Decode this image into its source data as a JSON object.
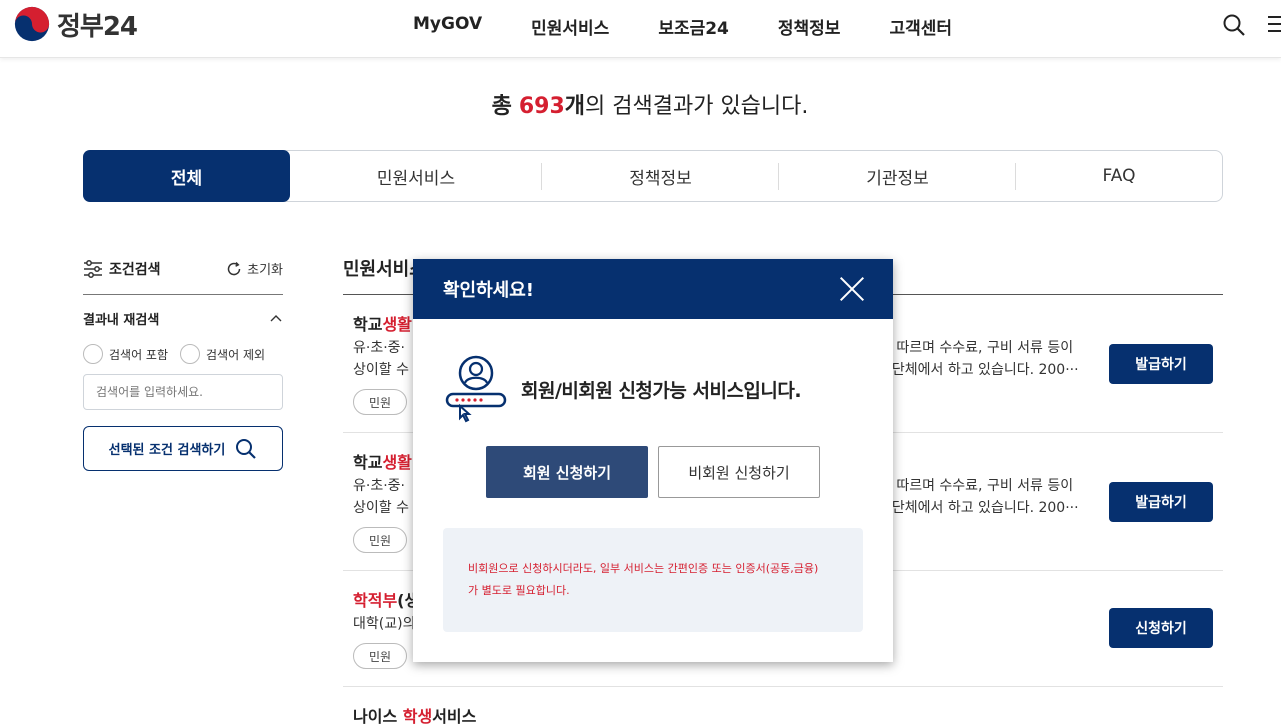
{
  "header": {
    "logo_text": "정부24",
    "nav": [
      "MyGOV",
      "민원서비스",
      "보조금24",
      "정책정보",
      "고객센터"
    ]
  },
  "result": {
    "prefix": "총",
    "count": "693",
    "unit": "개",
    "suffix": "의 검색결과가 있습니다."
  },
  "tabs": [
    {
      "label": "전체",
      "active": true
    },
    {
      "label": "민원서비스",
      "active": false
    },
    {
      "label": "정책정보",
      "active": false
    },
    {
      "label": "기관정보",
      "active": false
    },
    {
      "label": "FAQ",
      "active": false
    }
  ],
  "filter": {
    "title": "조건검색",
    "reset_label": "초기화",
    "refine_label": "결과내 재검색",
    "include_label": "검색어 포함",
    "exclude_label": "검색어 제외",
    "input_placeholder": "검색어를 입력하세요.",
    "search_button": "선택된 조건 검색하기"
  },
  "list": {
    "title": "민원서비스",
    "items": [
      {
        "title_plain": "학교",
        "title_hl": "생활",
        "desc_left_1": "유·초·중·",
        "desc_left_2": "상이할 수",
        "desc_right_1": "에 따르며 수수료, 구비 서류 등이",
        "desc_right_2": "지단체에서 하고 있습니다. 200···",
        "tag": "민원",
        "action": "발급하기"
      },
      {
        "title_plain": "학교",
        "title_hl": "생활",
        "desc_left_1": "유·초·중·",
        "desc_left_2": "상이할 수",
        "desc_right_1": "에 따르며 수수료, 구비 서류 등이",
        "desc_right_2": "지단체에서 하고 있습니다. 200···",
        "tag": "민원",
        "action": "발급하기"
      },
      {
        "title_plain": "(생",
        "title_hl": "학적부",
        "desc_left_1": "대학(교)의",
        "tag": "민원",
        "action": "신청하기"
      },
      {
        "title_plain": "나이스 ",
        "title_hl": "학생",
        "title_tail": "서비스"
      }
    ]
  },
  "modal": {
    "title": "확인하세요!",
    "message": "회원/비회원 신청가능 서비스입니다.",
    "member_button": "회원 신청하기",
    "guest_button": "비회원 신청하기",
    "notice_line1": "비회원으로 신청하시더라도, 일부 서비스는 간편인증 또는 인증서(공동,금융)",
    "notice_line2": "가 별도로 필요합니다."
  },
  "colors": {
    "navy": "#06306f",
    "accent_red": "#d51f30",
    "modal_primary_btn": "#2e4a78"
  }
}
